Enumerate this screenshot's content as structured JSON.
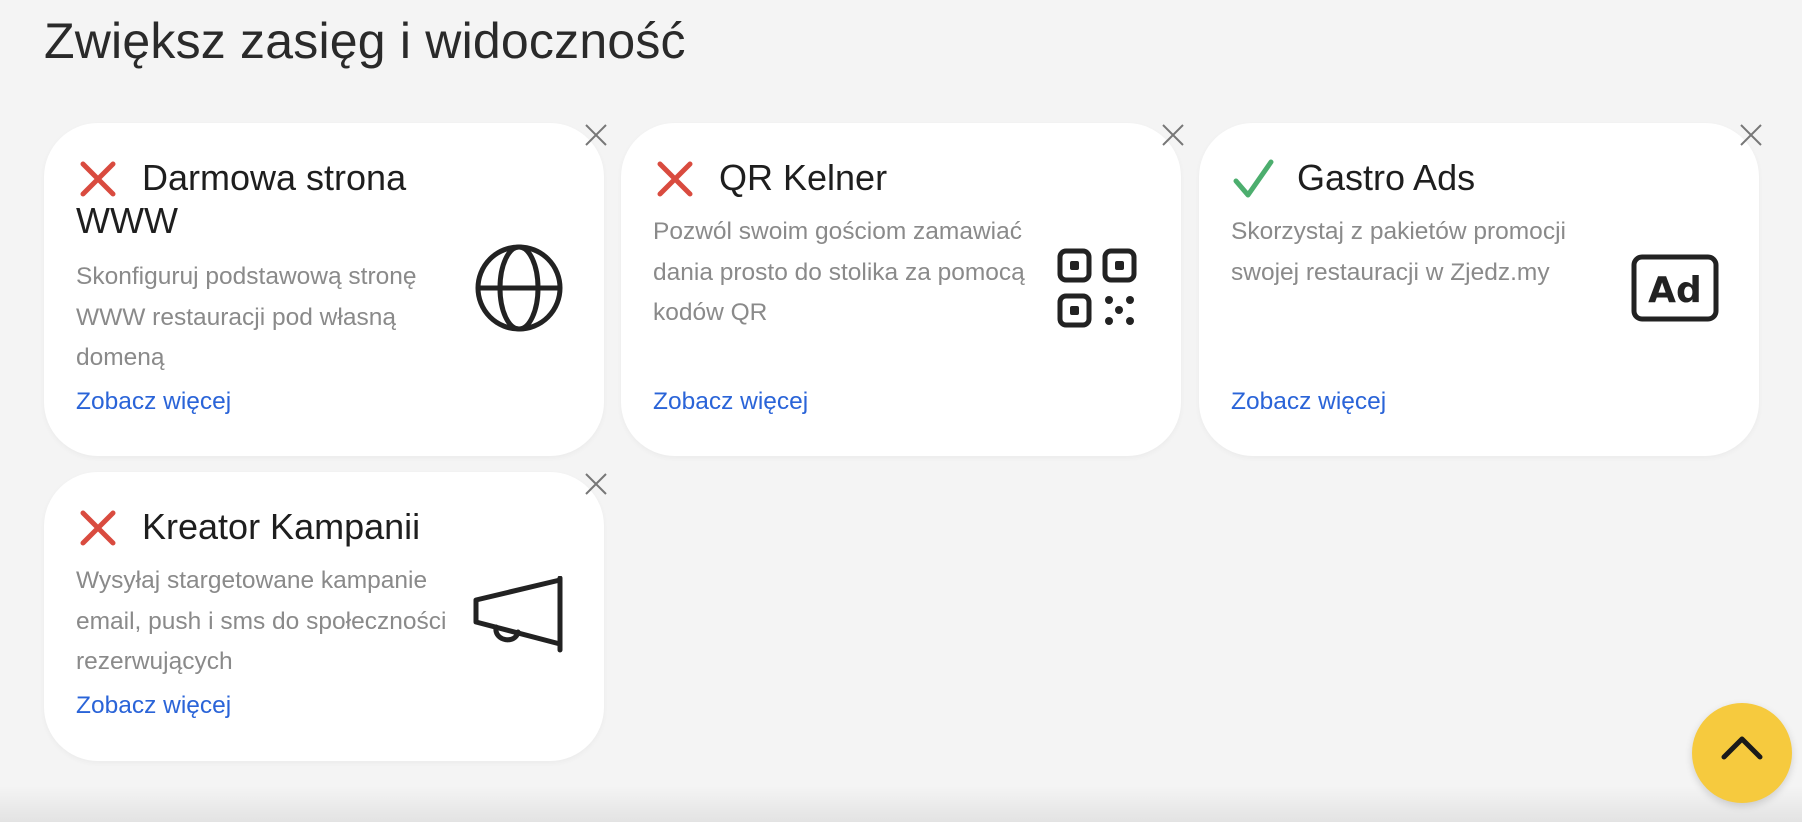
{
  "page": {
    "title": "Zwiększ zasięg i widoczność"
  },
  "colors": {
    "background": "#f4f4f4",
    "card": "#ffffff",
    "inactive_status": "#d94b3f",
    "active_status": "#4cae6e",
    "link": "#2a64d8",
    "scroll_button": "#f6ca3e"
  },
  "cards": [
    {
      "status": "inactive",
      "status_icon": "cross-icon",
      "title": "Darmowa strona WWW",
      "description": "Skonfiguruj podstawową stronę WWW restauracji pod własną domeną",
      "link_label": "Zobacz więcej",
      "illustration": "globe-icon"
    },
    {
      "status": "inactive",
      "status_icon": "cross-icon",
      "title": "QR Kelner",
      "description": "Pozwól swoim gościom zamawiać dania prosto do stolika za pomocą kodów QR",
      "link_label": "Zobacz więcej",
      "illustration": "qr-code-icon"
    },
    {
      "status": "active",
      "status_icon": "check-icon",
      "title": "Gastro Ads",
      "description": "Skorzystaj z pakietów promocji swojej restauracji w Zjedz.my",
      "link_label": "Zobacz więcej",
      "illustration": "ad-icon",
      "illustration_text": "Ad"
    },
    {
      "status": "inactive",
      "status_icon": "cross-icon",
      "title": "Kreator Kampanii",
      "description": "Wysyłaj stargetowane kampanie email, push i sms do społeczności rezerwujących",
      "link_label": "Zobacz więcej",
      "illustration": "megaphone-icon"
    }
  ],
  "scroll_top": {
    "icon": "chevron-up-icon"
  }
}
